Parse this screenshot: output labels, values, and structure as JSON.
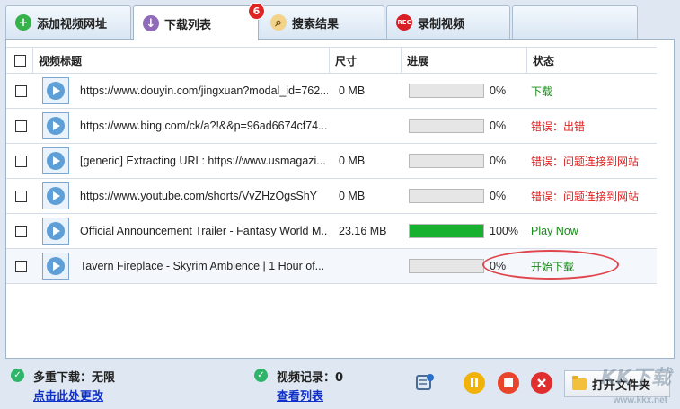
{
  "tabs": [
    {
      "label": "添加视频网址",
      "icon": "plus-icon",
      "color": "#36b24a"
    },
    {
      "label": "下载列表",
      "icon": "download-icon",
      "color": "#8f6bb8",
      "badge": "6"
    },
    {
      "label": "搜索结果",
      "icon": "search-icon",
      "color": "#e0a030"
    },
    {
      "label": "录制视频",
      "icon": "record-icon",
      "color": "#d81f26",
      "icon_text": "REC"
    }
  ],
  "table": {
    "headers": {
      "title": "视频标题",
      "size": "尺寸",
      "progress": "进展",
      "status": "状态"
    },
    "rows": [
      {
        "title": "https://www.douyin.com/jingxuan?modal_id=762...",
        "size": "0 MB",
        "progress": 0,
        "pct": "0%",
        "status": "下载",
        "status_type": "green"
      },
      {
        "title": "https://www.bing.com/ck/a?!&&p=96ad6674cf74...",
        "size": "",
        "progress": 0,
        "pct": "0%",
        "status": "错误：出错",
        "status_type": "red"
      },
      {
        "title": "[generic] Extracting URL: https://www.usmagazi...",
        "size": "0 MB",
        "progress": 0,
        "pct": "0%",
        "status": "错误：问题连接到网站",
        "status_type": "red"
      },
      {
        "title": "https://www.youtube.com/shorts/VvZHzOgsShY",
        "size": "0 MB",
        "progress": 0,
        "pct": "0%",
        "status": "错误：问题连接到网站",
        "status_type": "red"
      },
      {
        "title": "Official Announcement Trailer - Fantasy World M...",
        "size": "23.16 MB",
        "progress": 100,
        "pct": "100%",
        "status": "Play Now",
        "status_type": "link"
      },
      {
        "title": "Tavern Fireplace - Skyrim Ambience | 1 Hour of...",
        "size": "",
        "progress": 0,
        "pct": "0%",
        "status": "开始下载",
        "status_type": "green"
      }
    ]
  },
  "footer": {
    "multi_label": "多重下载：无限",
    "multi_link": "点击此处更改",
    "record_label": "视频记录：0",
    "record_link": "查看列表",
    "open_folder": "打开文件夹",
    "watermark": "KK下载",
    "watermark_url": "www.kkx.net"
  },
  "colors": {
    "progress_fill": "#17b12f",
    "error": "#e02020",
    "ok": "#178a17",
    "link": "#1030c8"
  }
}
